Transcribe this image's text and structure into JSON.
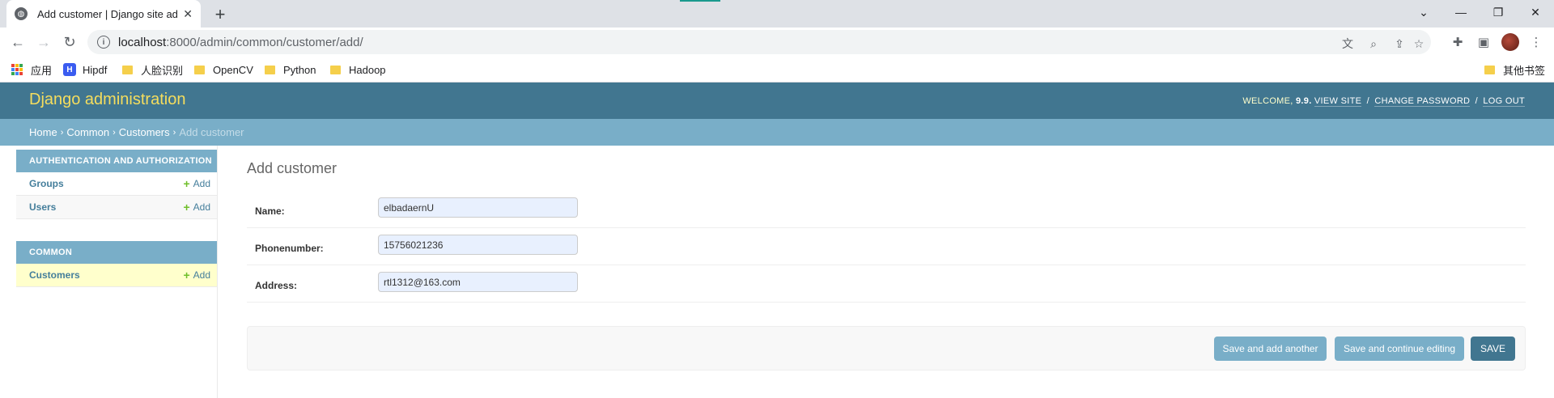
{
  "browser": {
    "tab_title": "Add customer | Django site ad",
    "url_host": "localhost",
    "url_path": ":8000/admin/common/customer/add/",
    "bookmarks": [
      {
        "label": "应用",
        "icon": "apps-icon"
      },
      {
        "label": "Hipdf",
        "icon": "hipdf-icon"
      },
      {
        "label": "人脸识别",
        "icon": "folder-icon"
      },
      {
        "label": "OpenCV",
        "icon": "folder-icon"
      },
      {
        "label": "Python",
        "icon": "folder-icon"
      },
      {
        "label": "Hadoop",
        "icon": "folder-icon"
      }
    ],
    "other_bookmarks": "其他书签"
  },
  "header": {
    "brand": "Django administration",
    "welcome": "WELCOME,",
    "username": "9.9",
    "view_site": "VIEW SITE",
    "change_password": "CHANGE PASSWORD",
    "log_out": "LOG OUT",
    "sep": "/"
  },
  "breadcrumbs": {
    "home": "Home",
    "app": "Common",
    "model": "Customers",
    "current": "Add customer",
    "separator": "›"
  },
  "sidebar": {
    "modules": [
      {
        "caption": "AUTHENTICATION AND AUTHORIZATION",
        "models": [
          {
            "name": "Groups",
            "add": "Add"
          },
          {
            "name": "Users",
            "add": "Add"
          }
        ]
      },
      {
        "caption": "COMMON",
        "models": [
          {
            "name": "Customers",
            "add": "Add"
          }
        ]
      }
    ]
  },
  "form": {
    "title": "Add customer",
    "fields": [
      {
        "label": "Name:",
        "value": "elbadaernU"
      },
      {
        "label": "Phonenumber:",
        "value": "15756021236"
      },
      {
        "label": "Address:",
        "value": "rtl1312@163.com"
      }
    ],
    "buttons": {
      "save_add_another": "Save and add another",
      "save_continue": "Save and continue editing",
      "save": "SAVE"
    }
  },
  "colors": {
    "header_bg": "#417690",
    "breadcrumb_bg": "#79aec8",
    "brand_yellow": "#f5dd5d",
    "add_green": "#70bf2b",
    "selected_row": "#ffffcc"
  }
}
